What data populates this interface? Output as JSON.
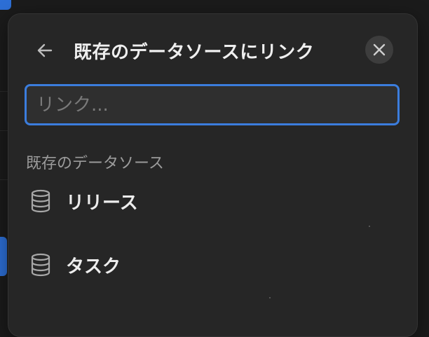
{
  "header": {
    "title": "既存のデータソースにリンク",
    "back_icon": "arrow-left-icon",
    "close_icon": "close-icon"
  },
  "search": {
    "placeholder": "リンク...",
    "value": ""
  },
  "section": {
    "label": "既存のデータソース"
  },
  "items": [
    {
      "label": "リリース",
      "icon": "database-icon"
    },
    {
      "label": "タスク",
      "icon": "database-icon"
    }
  ],
  "colors": {
    "panel_bg": "#262626",
    "accent": "#3b7ddd",
    "text_primary": "#efefef",
    "text_secondary": "#9b9b9b"
  }
}
